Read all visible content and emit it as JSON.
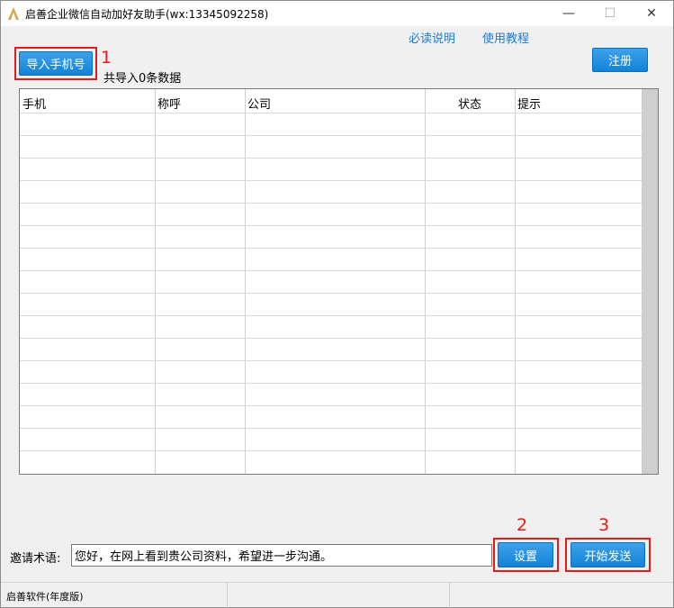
{
  "window": {
    "title": "启善企业微信自动加好友助手(wx:13345092258)",
    "controls": {
      "minimize": "—",
      "maximize": "☐",
      "close": "✕"
    }
  },
  "links": {
    "read_me": "必读说明",
    "tutorial": "使用教程"
  },
  "toolbar": {
    "import_label": "导入手机号",
    "import_count_text": "共导入0条数据",
    "register_label": "注册"
  },
  "annotations": {
    "step1": "1",
    "step2": "2",
    "step3": "3"
  },
  "table": {
    "columns": [
      "手机",
      "称呼",
      "公司",
      "状态",
      "提示"
    ],
    "rows": []
  },
  "invite": {
    "label": "邀请术语:",
    "value": "您好，在网上看到贵公司资料，希望进一步沟通。"
  },
  "actions": {
    "settings_label": "设置",
    "start_label": "开始发送"
  },
  "statusbar": {
    "segment1": "启善软件(年度版)",
    "segment2": "",
    "segment3": ""
  },
  "colors": {
    "accent": "#1283d8",
    "link": "#1a7bd6",
    "annotation": "#e81919"
  },
  "icons": {
    "app": "app-logo-icon"
  }
}
